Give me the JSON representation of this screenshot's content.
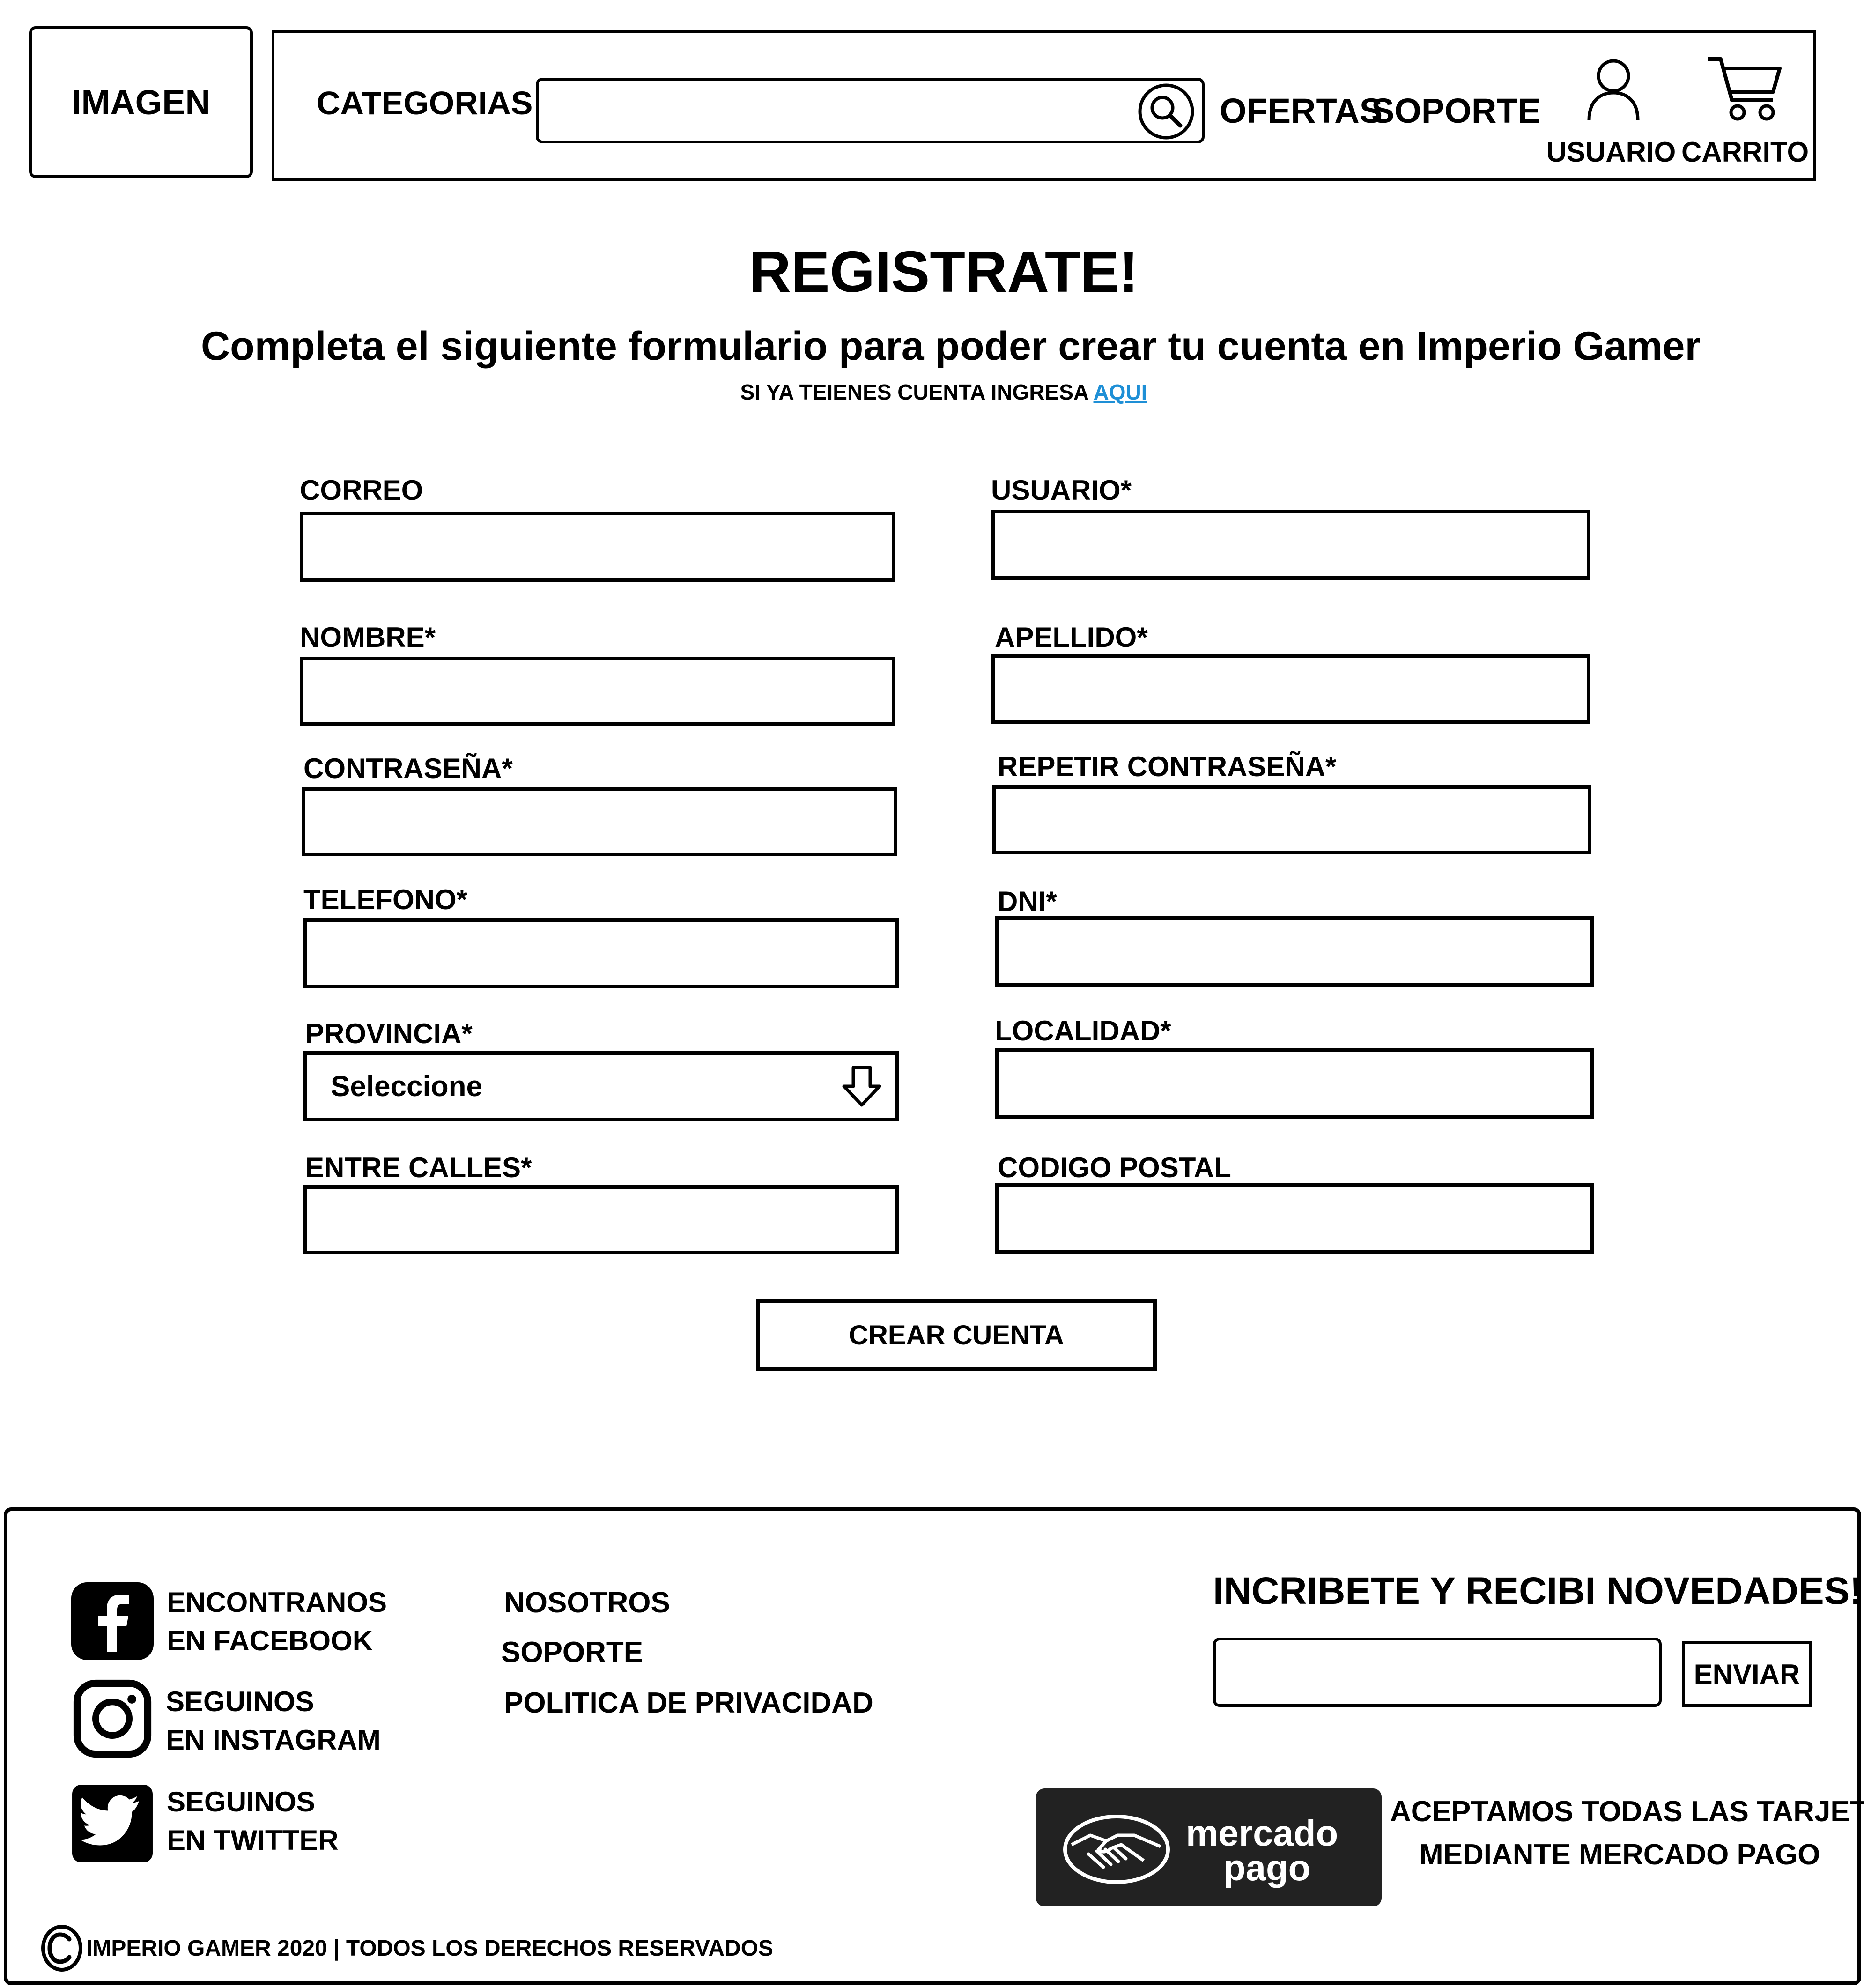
{
  "header": {
    "logo_placeholder": "IMAGEN",
    "categories_label": "CATEGORIAS",
    "search": {
      "value": "",
      "placeholder": "",
      "icon": "search-icon"
    },
    "ofertas_label": "OFERTAS",
    "soporte_label": "SOPORTE",
    "user_label": "USUARIO",
    "user_icon": "user-icon",
    "cart_label": "CARRITO",
    "cart_icon": "cart-icon"
  },
  "main": {
    "title": "REGISTRATE!",
    "subtitle": "Completa el siguiente formulario para poder crear tu cuenta en Imperio Gamer",
    "login_prompt": "SI YA TEIENES CUENTA INGRESA",
    "login_link": "AQUI"
  },
  "form": {
    "left": [
      {
        "label": "CORREO",
        "value": ""
      },
      {
        "label": "NOMBRE*",
        "value": ""
      },
      {
        "label": "CONTRASEÑA*",
        "value": ""
      },
      {
        "label": "TELEFONO*",
        "value": ""
      },
      {
        "label": "PROVINCIA*",
        "value": "Seleccione",
        "icon": "arrow-down-icon"
      },
      {
        "label": "ENTRE CALLES*",
        "value": ""
      }
    ],
    "right": [
      {
        "label": "USUARIO*",
        "value": ""
      },
      {
        "label": "APELLIDO*",
        "value": ""
      },
      {
        "label": "REPETIR CONTRASEÑA*",
        "value": ""
      },
      {
        "label": "DNI*",
        "value": ""
      },
      {
        "label": "LOCALIDAD*",
        "value": ""
      },
      {
        "label": "CODIGO POSTAL",
        "value": ""
      }
    ],
    "submit_label": "CREAR CUENTA"
  },
  "footer": {
    "social": [
      {
        "icon": "facebook-icon",
        "line1": "ENCONTRANOS",
        "line2": "EN FACEBOOK"
      },
      {
        "icon": "instagram-icon",
        "line1": "SEGUINOS",
        "line2": "EN INSTAGRAM"
      },
      {
        "icon": "twitter-icon",
        "line1": "SEGUINOS",
        "line2": "EN TWITTER"
      }
    ],
    "links": [
      "NOSOTROS",
      "SOPORTE",
      "POLITICA DE PRIVACIDAD"
    ],
    "newsletter": {
      "title": "INCRIBETE Y RECIBI NOVEDADES!",
      "value": "",
      "button": "ENVIAR"
    },
    "payment": {
      "logo": "mercado-pago-logo",
      "wordmark_line1": "mercado",
      "wordmark_line2": "pago",
      "line1": "ACEPTAMOS TODAS LAS TARJETAS",
      "line2": "MEDIANTE MERCADO PAGO"
    },
    "copyright_icon": "copyright-icon",
    "copyright": "IMPERIO GAMER 2020 | TODOS LOS DERECHOS RESERVADOS"
  },
  "colors": {
    "link": "#1e8fd6",
    "badge_bg": "#222222",
    "icon_bg": "#000000"
  }
}
